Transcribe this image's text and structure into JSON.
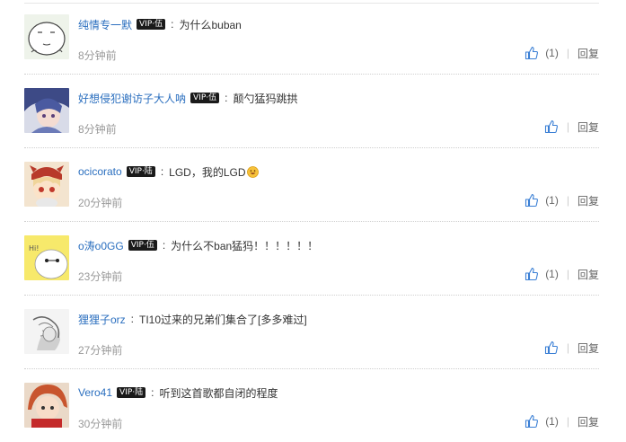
{
  "comments": [
    {
      "user": "纯情专一默",
      "badge": "VIP·伍",
      "text": "为什么buban",
      "time": "8分钟前",
      "likes": "(1)",
      "reply": "回复",
      "avatar_icon": "blank-face-avatar"
    },
    {
      "user": "好想侵犯谢访子大人呐",
      "badge": "VIP·伍",
      "text": "颠勺猛犸跳拱",
      "time": "8分钟前",
      "likes": "",
      "reply": "回复",
      "avatar_icon": "anime-girl-avatar"
    },
    {
      "user": "ocicorato",
      "badge": "VIP·陆",
      "text": "LGD，我的LGD",
      "time": "20分钟前",
      "likes": "(1)",
      "reply": "回复",
      "avatar_icon": "klee-avatar",
      "emoji": "grin-emoji"
    },
    {
      "user": "o涛o0GG",
      "badge": "VIP·伍",
      "text": "为什么不ban猛犸！！！！！！",
      "time": "23分钟前",
      "likes": "(1)",
      "reply": "回复",
      "avatar_icon": "baymax-avatar"
    },
    {
      "user": "狸狸子orz",
      "badge": "",
      "text": "TI10过来的兄弟们集合了[多多难过]",
      "time": "27分钟前",
      "likes": "",
      "reply": "回复",
      "avatar_icon": "sketch-avatar"
    },
    {
      "user": "Vero41",
      "badge": "VIP·陆",
      "text": "听到这首歌都自闭的程度",
      "time": "30分钟前",
      "likes": "(1)",
      "reply": "回复",
      "avatar_icon": "redhair-avatar"
    }
  ],
  "colors": {
    "username": "#2b6fbf",
    "thumb": "#3a7fd5",
    "muted": "#999999"
  }
}
